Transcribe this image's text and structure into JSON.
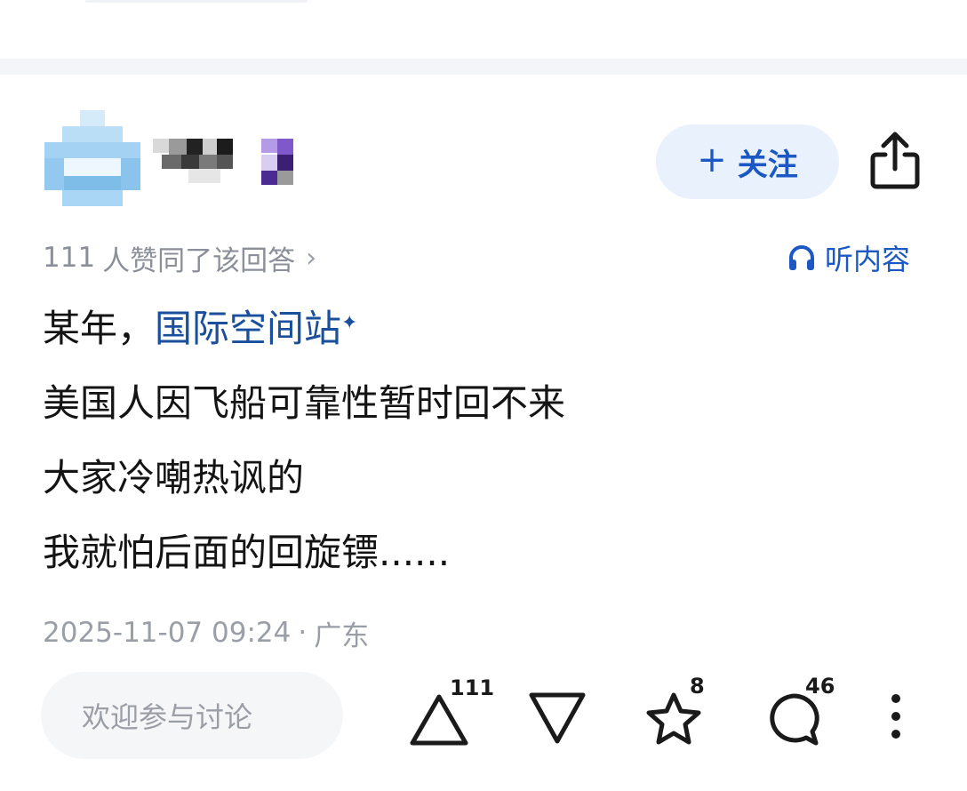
{
  "author": {
    "follow_plus": "+",
    "follow_label": "关注"
  },
  "meta": {
    "agree_count": "111",
    "agree_text": "人赞同了该回答",
    "agree_chevron": "›",
    "listen_label": "听内容"
  },
  "content": {
    "line1_prefix": "某年，",
    "line1_link": "国际空间站",
    "line1_link_mark": "✦",
    "line2": "美国人因飞船可靠性暂时回不来",
    "line3": "大家冷嘲热讽的",
    "line4": "我就怕后面的回旋镖......"
  },
  "footer": {
    "datetime": "2025-11-07 09:24",
    "separator": "·",
    "location": "广东"
  },
  "actions": {
    "comment_placeholder": "欢迎参与讨论",
    "upvote_count": "111",
    "favorite_count": "8",
    "comment_count": "46"
  },
  "colors": {
    "accent": "#1b58c4",
    "follow_bg": "#e9f1fd",
    "text_primary": "#141414",
    "text_secondary": "#8b8f99",
    "divider": "#f4f5f8"
  },
  "icons": {
    "share": "share-icon",
    "headphones": "headphones-icon",
    "upvote": "upvote-triangle-icon",
    "downvote": "downvote-triangle-icon",
    "favorite": "star-icon",
    "comment": "comment-bubble-icon",
    "more": "more-vertical-icon"
  }
}
